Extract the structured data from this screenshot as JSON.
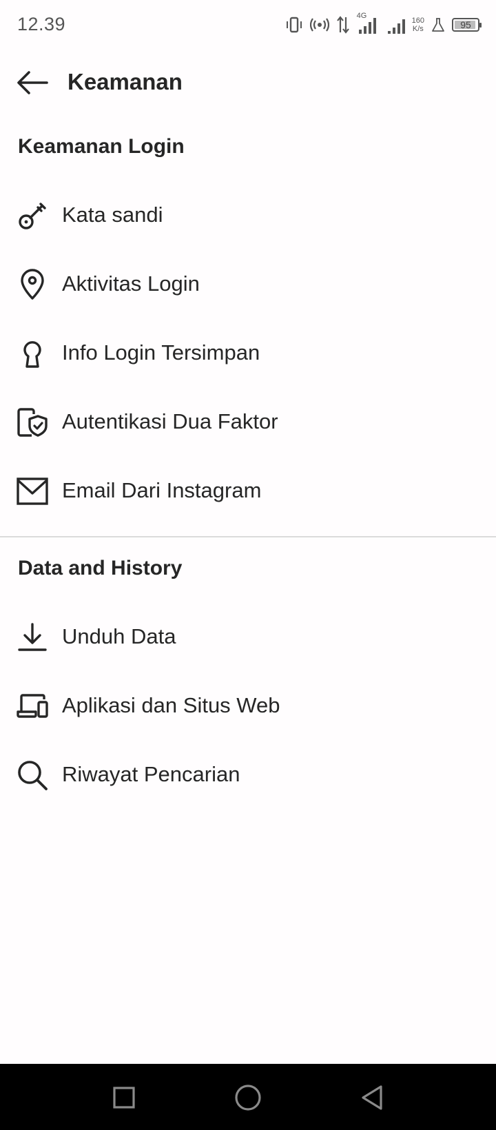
{
  "status_bar": {
    "time": "12.39",
    "network": "4G",
    "speed_value": "160",
    "speed_unit": "K/s",
    "battery": "95",
    "battery_level": 0.95
  },
  "header": {
    "title": "Keamanan"
  },
  "sections": {
    "login": {
      "title": "Keamanan Login",
      "items": [
        {
          "label": "Kata sandi",
          "icon": "key-icon"
        },
        {
          "label": "Aktivitas Login",
          "icon": "location-pin-icon"
        },
        {
          "label": "Info Login Tersimpan",
          "icon": "keyhole-icon"
        },
        {
          "label": "Autentikasi Dua Faktor",
          "icon": "phone-shield-icon"
        },
        {
          "label": "Email Dari Instagram",
          "icon": "mail-icon"
        }
      ]
    },
    "data": {
      "title": "Data and History",
      "items": [
        {
          "label": "Unduh Data",
          "icon": "download-icon"
        },
        {
          "label": "Aplikasi dan Situs Web",
          "icon": "devices-icon"
        },
        {
          "label": "Riwayat Pencarian",
          "icon": "search-icon"
        }
      ]
    }
  },
  "nav_bar": {
    "buttons": [
      "recents-square-icon",
      "home-circle-icon",
      "back-triangle-icon"
    ]
  }
}
